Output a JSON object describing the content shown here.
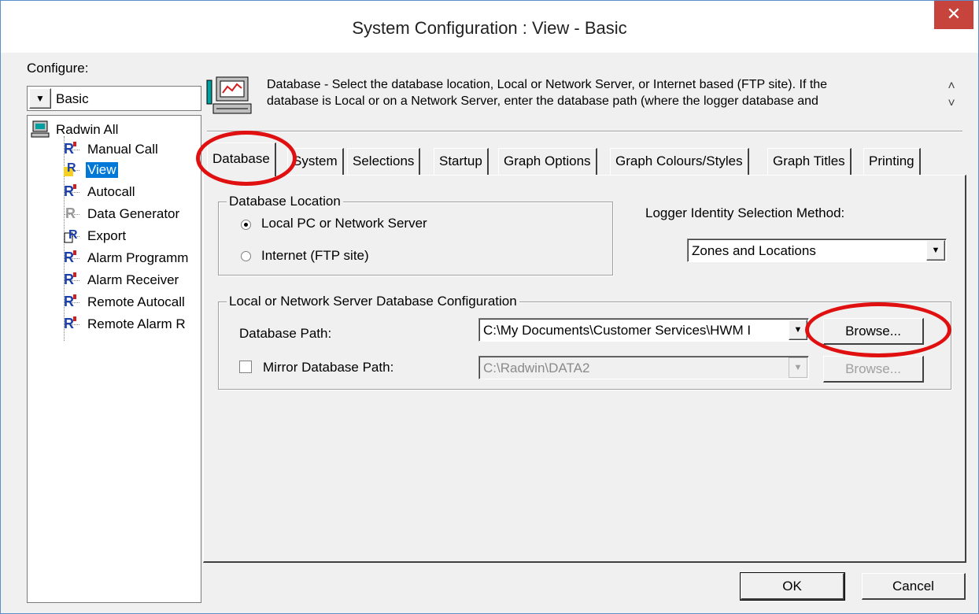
{
  "window": {
    "title": "System Configuration : View - Basic",
    "close_glyph": "✕"
  },
  "sidebar": {
    "configure_label": "Configure:",
    "configure_value": "Basic",
    "tree_root": "Radwin All",
    "tree_items": [
      {
        "label": "Manual Call"
      },
      {
        "label": "View"
      },
      {
        "label": "Autocall"
      },
      {
        "label": "Data Generator"
      },
      {
        "label": "Export"
      },
      {
        "label": "Alarm Programm"
      },
      {
        "label": "Alarm Receiver"
      },
      {
        "label": "Remote Autocall"
      },
      {
        "label": "Remote Alarm R"
      }
    ],
    "selected_item": "View"
  },
  "description": {
    "line1": "Database - Select the database location, Local or Network Server, or Internet based (FTP site). If the",
    "line2": "database is Local or on a Network Server, enter the database path (where the logger database and",
    "scroll_up": "˄",
    "scroll_down": "˅"
  },
  "tabs": [
    "Database",
    "System",
    "Selections",
    "Startup",
    "Graph Options",
    "Graph Colours/Styles",
    "Graph Titles",
    "Printing"
  ],
  "database_tab": {
    "location_group_title": "Database Location",
    "radio_local": "Local PC or Network Server",
    "radio_internet": "Internet (FTP site)",
    "logger_identity_label": "Logger Identity Selection Method:",
    "logger_identity_value": "Zones and Locations",
    "config_group_title": "Local or Network Server Database Configuration",
    "db_path_label": "Database Path:",
    "db_path_value": "C:\\My Documents\\Customer Services\\HWM I",
    "browse_label": "Browse...",
    "mirror_label": "Mirror Database Path:",
    "mirror_value": "C:\\Radwin\\DATA2",
    "mirror_browse_label": "Browse..."
  },
  "buttons": {
    "ok": "OK",
    "cancel": "Cancel"
  },
  "colors": {
    "highlight_ring": "#e01010",
    "selection": "#0078d7",
    "close": "#c7443c"
  }
}
